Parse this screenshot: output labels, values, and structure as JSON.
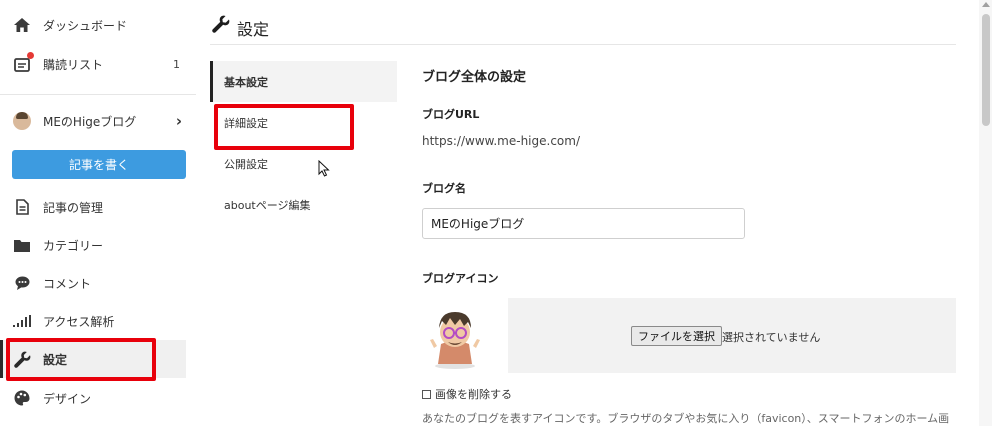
{
  "sidebar": {
    "items": [
      {
        "label": "ダッシュボード",
        "icon": "home-icon"
      },
      {
        "label": "購読リスト",
        "icon": "reading-list-icon",
        "count": "1"
      },
      {
        "label": "MEのHigeブログ",
        "icon": "blog-avatar-icon"
      },
      {
        "label": "記事の管理",
        "icon": "document-icon"
      },
      {
        "label": "カテゴリー",
        "icon": "folder-icon"
      },
      {
        "label": "コメント",
        "icon": "comment-icon"
      },
      {
        "label": "アクセス解析",
        "icon": "bar-chart-icon"
      },
      {
        "label": "設定",
        "icon": "wrench-icon",
        "active": true
      },
      {
        "label": "デザイン",
        "icon": "palette-icon"
      }
    ],
    "write_button": "記事を書く"
  },
  "header": {
    "title": "設定",
    "icon": "wrench-icon"
  },
  "subnav": {
    "items": [
      {
        "label": "基本設定",
        "active": true
      },
      {
        "label": "詳細設定"
      },
      {
        "label": "公開設定"
      },
      {
        "label": "aboutページ編集"
      }
    ]
  },
  "main": {
    "section_title": "ブログ全体の設定",
    "blog_url_label": "ブログURL",
    "blog_url_value": "https://www.me-hige.com/",
    "blog_name_label": "ブログ名",
    "blog_name_value": "MEのHigeブログ",
    "blog_icon_label": "ブログアイコン",
    "file_button": "ファイルを選択",
    "file_status": "選択されていません",
    "delete_image_label": "画像を削除する",
    "description": "あなたのブログを表すアイコンです。ブラウザのタブやお気に入り（favicon）、スマートフォンのホーム画"
  },
  "colors": {
    "accent": "#3d9be0",
    "highlight": "#e8000b",
    "active_bg": "#f0f0f0"
  }
}
